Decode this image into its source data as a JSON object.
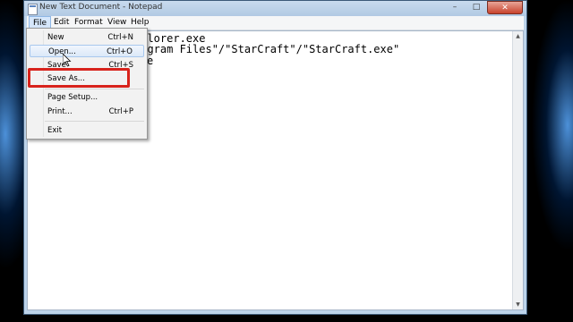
{
  "window": {
    "title": "New Text Document - Notepad",
    "controls": {
      "minimize": "–",
      "maximize": "□",
      "close": "✕"
    }
  },
  "menubar": {
    "items": [
      "File",
      "Edit",
      "Format",
      "View",
      "Help"
    ],
    "active": "File"
  },
  "editor": {
    "lines": [
      "xplorer.exe",
      "rogram Files\"/\"StarCraft\"/\"StarCraft.exe\"",
      "e"
    ]
  },
  "file_menu": {
    "items": [
      {
        "label": "New",
        "shortcut": "Ctrl+N"
      },
      {
        "label": "Open...",
        "shortcut": "Ctrl+O"
      },
      {
        "label": "Save",
        "shortcut": "Ctrl+S"
      },
      {
        "label": "Save As...",
        "shortcut": ""
      },
      {
        "label": "Page Setup...",
        "shortcut": ""
      },
      {
        "label": "Print...",
        "shortcut": "Ctrl+P"
      },
      {
        "label": "Exit",
        "shortcut": ""
      }
    ],
    "hovered": "Open..."
  },
  "annotation": {
    "color": "#d8231c"
  },
  "icons": [
    "notepad-icon",
    "mouse-cursor-icon",
    "scroll-up-icon",
    "scroll-down-icon"
  ]
}
